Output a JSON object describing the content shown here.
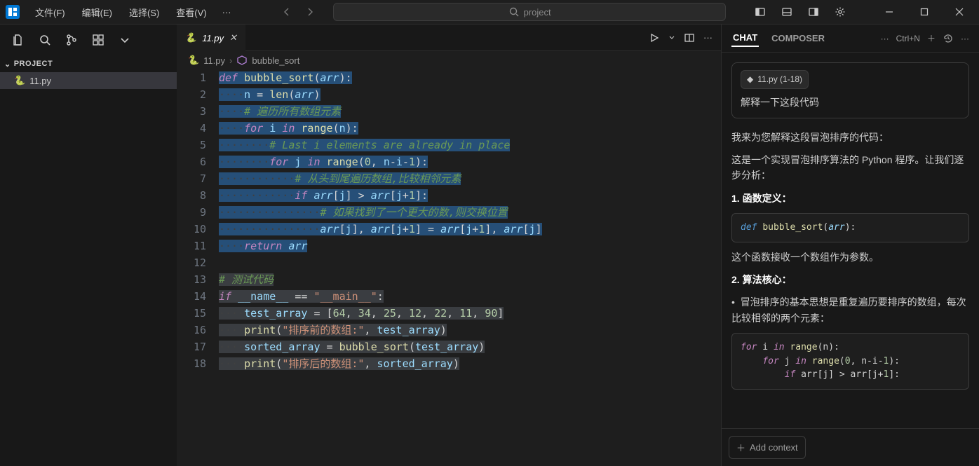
{
  "menubar": {
    "file": "文件(F)",
    "edit": "编辑(E)",
    "select": "选择(S)",
    "view": "查看(V)",
    "more": "···"
  },
  "search": {
    "placeholder": "project"
  },
  "sidebar": {
    "header": "PROJECT",
    "items": [
      {
        "label": "11.py"
      }
    ]
  },
  "tab": {
    "label": "11.py"
  },
  "breadcrumbs": {
    "file": "11.py",
    "symbol": "bubble_sort"
  },
  "chat": {
    "tabs": {
      "chat": "CHAT",
      "composer": "COMPOSER"
    },
    "shortcut": "Ctrl+N",
    "chip": "11.py (1-18)",
    "user_msg": "解释一下这段代码",
    "p1": "我来为您解释这段冒泡排序的代码：",
    "p2": "这是一个实现冒泡排序算法的 Python 程序。让我们逐步分析：",
    "h1": "1. 函数定义：",
    "p3": "这个函数接收一个数组作为参数。",
    "h2": "2. 算法核心：",
    "b1": "冒泡排序的基本思想是重复遍历要排序的数组，每次比较相邻的两个元素：",
    "add_context": "Add context"
  },
  "code": {
    "lines": [
      {
        "n": 1,
        "tokens": [
          [
            "kw",
            "def"
          ],
          [
            "op",
            " "
          ],
          [
            "fn",
            "bubble_sort"
          ],
          [
            "pn",
            "("
          ],
          [
            "param",
            "arr"
          ],
          [
            "pn",
            ")"
          ],
          [
            "pn",
            ":"
          ]
        ]
      },
      {
        "n": 2,
        "pre": "····",
        "tokens": [
          [
            "var",
            "n"
          ],
          [
            "op",
            " = "
          ],
          [
            "lf",
            "len"
          ],
          [
            "pn",
            "("
          ],
          [
            "param",
            "arr"
          ],
          [
            "pn",
            ")"
          ]
        ]
      },
      {
        "n": 3,
        "pre": "····",
        "tokens": [
          [
            "cm",
            "# 遍历所有数组元素"
          ]
        ]
      },
      {
        "n": 4,
        "pre": "····",
        "tokens": [
          [
            "kw",
            "for"
          ],
          [
            "op",
            " "
          ],
          [
            "var",
            "i"
          ],
          [
            "op",
            " "
          ],
          [
            "kw",
            "in"
          ],
          [
            "op",
            " "
          ],
          [
            "lf",
            "range"
          ],
          [
            "pn",
            "("
          ],
          [
            "var",
            "n"
          ],
          [
            "pn",
            ")"
          ],
          [
            "pn",
            ":"
          ]
        ]
      },
      {
        "n": 5,
        "pre": "········",
        "tokens": [
          [
            "cm",
            "# Last i elements are already in place"
          ]
        ]
      },
      {
        "n": 6,
        "pre": "········",
        "tokens": [
          [
            "kw",
            "for"
          ],
          [
            "op",
            " "
          ],
          [
            "var",
            "j"
          ],
          [
            "op",
            " "
          ],
          [
            "kw",
            "in"
          ],
          [
            "op",
            " "
          ],
          [
            "lf",
            "range"
          ],
          [
            "pn",
            "("
          ],
          [
            "num",
            "0"
          ],
          [
            "pn",
            ", "
          ],
          [
            "var",
            "n"
          ],
          [
            "op",
            "-"
          ],
          [
            "var",
            "i"
          ],
          [
            "op",
            "-"
          ],
          [
            "num",
            "1"
          ],
          [
            "pn",
            ")"
          ],
          [
            "pn",
            ":"
          ]
        ]
      },
      {
        "n": 7,
        "pre": "············",
        "tokens": [
          [
            "cm",
            "# 从头到尾遍历数组,比较相邻元素"
          ]
        ]
      },
      {
        "n": 8,
        "pre": "············",
        "tokens": [
          [
            "kw",
            "if"
          ],
          [
            "op",
            " "
          ],
          [
            "param",
            "arr"
          ],
          [
            "pn",
            "["
          ],
          [
            "var",
            "j"
          ],
          [
            "pn",
            "]"
          ],
          [
            "op",
            " > "
          ],
          [
            "param",
            "arr"
          ],
          [
            "pn",
            "["
          ],
          [
            "var",
            "j"
          ],
          [
            "op",
            "+"
          ],
          [
            "num",
            "1"
          ],
          [
            "pn",
            "]"
          ],
          [
            "pn",
            ":"
          ]
        ]
      },
      {
        "n": 9,
        "pre": "················",
        "tokens": [
          [
            "cm",
            "# 如果找到了一个更大的数,则交换位置"
          ]
        ]
      },
      {
        "n": 10,
        "pre": "················",
        "tokens": [
          [
            "param",
            "arr"
          ],
          [
            "pn",
            "["
          ],
          [
            "var",
            "j"
          ],
          [
            "pn",
            "]"
          ],
          [
            "pn",
            ", "
          ],
          [
            "param",
            "arr"
          ],
          [
            "pn",
            "["
          ],
          [
            "var",
            "j"
          ],
          [
            "op",
            "+"
          ],
          [
            "num",
            "1"
          ],
          [
            "pn",
            "]"
          ],
          [
            "op",
            " = "
          ],
          [
            "param",
            "arr"
          ],
          [
            "pn",
            "["
          ],
          [
            "var",
            "j"
          ],
          [
            "op",
            "+"
          ],
          [
            "num",
            "1"
          ],
          [
            "pn",
            "]"
          ],
          [
            "pn",
            ", "
          ],
          [
            "param",
            "arr"
          ],
          [
            "pn",
            "["
          ],
          [
            "var",
            "j"
          ],
          [
            "pn",
            "]"
          ]
        ]
      },
      {
        "n": 11,
        "pre": "····",
        "tokens": [
          [
            "kw",
            "return"
          ],
          [
            "op",
            " "
          ],
          [
            "param",
            "arr"
          ]
        ]
      },
      {
        "n": 12,
        "tokens": []
      },
      {
        "n": 13,
        "tokens": [
          [
            "cm",
            "# 测试代码"
          ]
        ]
      },
      {
        "n": 14,
        "tokens": [
          [
            "kw",
            "if"
          ],
          [
            "op",
            " "
          ],
          [
            "var",
            "__name__"
          ],
          [
            "op",
            " == "
          ],
          [
            "str",
            "\"__main__\""
          ],
          [
            "pn",
            ":"
          ]
        ]
      },
      {
        "n": 15,
        "pre": "····",
        "tokens": [
          [
            "var",
            "test_array"
          ],
          [
            "op",
            " = "
          ],
          [
            "pn",
            "["
          ],
          [
            "num",
            "64"
          ],
          [
            "pn",
            ", "
          ],
          [
            "num",
            "34"
          ],
          [
            "pn",
            ", "
          ],
          [
            "num",
            "25"
          ],
          [
            "pn",
            ", "
          ],
          [
            "num",
            "12"
          ],
          [
            "pn",
            ", "
          ],
          [
            "num",
            "22"
          ],
          [
            "pn",
            ", "
          ],
          [
            "num",
            "11"
          ],
          [
            "pn",
            ", "
          ],
          [
            "num",
            "90"
          ],
          [
            "pn",
            "]"
          ]
        ]
      },
      {
        "n": 16,
        "pre": "····",
        "tokens": [
          [
            "lf",
            "print"
          ],
          [
            "pn",
            "("
          ],
          [
            "str",
            "\"排序前的数组:\""
          ],
          [
            "pn",
            ", "
          ],
          [
            "var",
            "test_array"
          ],
          [
            "pn",
            ")"
          ]
        ]
      },
      {
        "n": 17,
        "pre": "····",
        "tokens": [
          [
            "var",
            "sorted_array"
          ],
          [
            "op",
            " = "
          ],
          [
            "fn",
            "bubble_sort"
          ],
          [
            "pn",
            "("
          ],
          [
            "var",
            "test_array"
          ],
          [
            "pn",
            ")"
          ]
        ]
      },
      {
        "n": 18,
        "pre": "····",
        "tokens": [
          [
            "lf",
            "print"
          ],
          [
            "pn",
            "("
          ],
          [
            "str",
            "\"排序后的数组:\""
          ],
          [
            "pn",
            ", "
          ],
          [
            "var",
            "sorted_array"
          ],
          [
            "pn",
            ")"
          ]
        ]
      }
    ]
  }
}
